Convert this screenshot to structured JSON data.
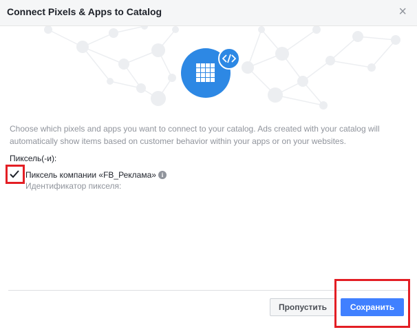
{
  "dialog": {
    "title": "Connect Pixels & Apps to Catalog",
    "close_label": "×"
  },
  "hero": {
    "main_icon": "grid-app-icon",
    "badge_icon": "code-icon",
    "badge_text": "</>"
  },
  "description": "Choose which pixels and apps you want to connect to your catalog. Ads created with your catalog will automatically show items based on customer behavior within your apps or on your websites.",
  "pixels": {
    "section_label": "Пиксель(-и):",
    "items": [
      {
        "name": "Пиксель компании «FB_Реклама»",
        "checked": true,
        "info_icon": "info-icon",
        "id_label": "Идентификатор пикселя:"
      }
    ]
  },
  "footer": {
    "skip_label": "Пропустить",
    "save_label": "Сохранить"
  },
  "colors": {
    "accent": "#4080ff",
    "hero_blue": "#2d88e4",
    "highlight": "#e31e24",
    "muted_text": "#90949c"
  }
}
